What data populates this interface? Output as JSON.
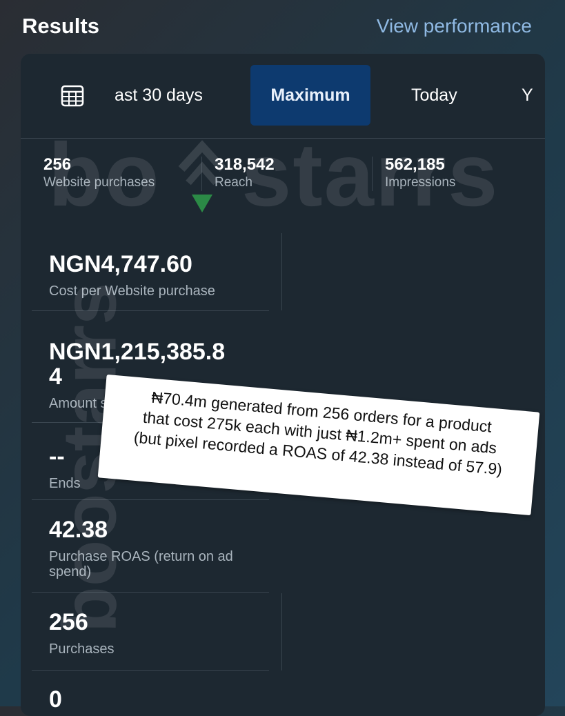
{
  "header": {
    "title": "Results",
    "view_link": "View performance"
  },
  "tabs": [
    {
      "label": "ast 30 days"
    },
    {
      "label": "Maximum",
      "selected": true
    },
    {
      "label": "Today"
    },
    {
      "label": "Y"
    }
  ],
  "stats": [
    {
      "value": "256",
      "label": "Website purchases"
    },
    {
      "value": "318,542",
      "label": "Reach"
    },
    {
      "value": "562,185",
      "label": "Impressions"
    }
  ],
  "metrics": [
    {
      "value": "NGN4,747.60",
      "label": "Cost per Website purchase"
    },
    {
      "value": "NGN1,215,385.8",
      "value_line2": "4",
      "label": "Amount s"
    },
    {
      "value": "--",
      "label": "Ends"
    },
    {
      "value": "42.38",
      "label": "Purchase ROAS (return on ad",
      "label_line2": "spend)"
    },
    {
      "value": "256",
      "label": "Purchases"
    },
    {
      "value": "0"
    }
  ],
  "note": {
    "line1": "₦70.4m generated from 256 orders for a product",
    "line2": "that cost 275k each with just ₦1.2m+ spent on ads",
    "line3": "(but pixel recorded a ROAS of 42.38 instead of 57.9)"
  },
  "watermark": {
    "text_h": "bo",
    "text_h2": "starrs",
    "text_v": "boostarrs"
  },
  "colors": {
    "accent": "#8fb9e3",
    "selected_tab": "#0d3a6f",
    "card": "#1d2831"
  }
}
